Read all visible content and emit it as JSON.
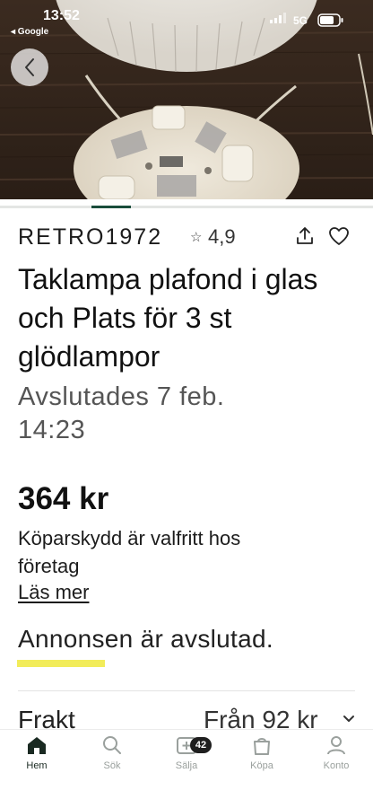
{
  "status_bar": {
    "time": "13:52",
    "back_app": "◂ Google",
    "network": "5G"
  },
  "gallery": {
    "image_description_icon": "product-photo",
    "active_index": 1
  },
  "seller": {
    "name": "RETRO1972",
    "rating_star": "☆",
    "rating": "4,9"
  },
  "listing": {
    "title": "Taklampa plafond i glas och Plats för 3 st glödlampor",
    "ended_date": "Avslutades 7 feb. 14:23",
    "price": "364 kr",
    "buyer_protection": "Köparskydd är valfritt hos företag",
    "read_more": "Läs mer",
    "ad_ended": "Annonsen är avslutad."
  },
  "shipping": {
    "label": "Frakt",
    "value": "Från 92 kr"
  },
  "bottom_nav": {
    "items": [
      {
        "label": "Hem",
        "icon": "home-icon",
        "active": true
      },
      {
        "label": "Sök",
        "icon": "search-icon",
        "active": false
      },
      {
        "label": "Sälja",
        "icon": "sell-icon",
        "badge": "42",
        "active": false
      },
      {
        "label": "Köpa",
        "icon": "shopping-bag-icon",
        "active": false
      },
      {
        "label": "Konto",
        "icon": "account-icon",
        "active": false
      }
    ]
  },
  "colors": {
    "accent_green": "#1a4d3b",
    "highlight_yellow": "#f2ec5a",
    "text": "#1c1c1c",
    "muted": "#555555"
  }
}
